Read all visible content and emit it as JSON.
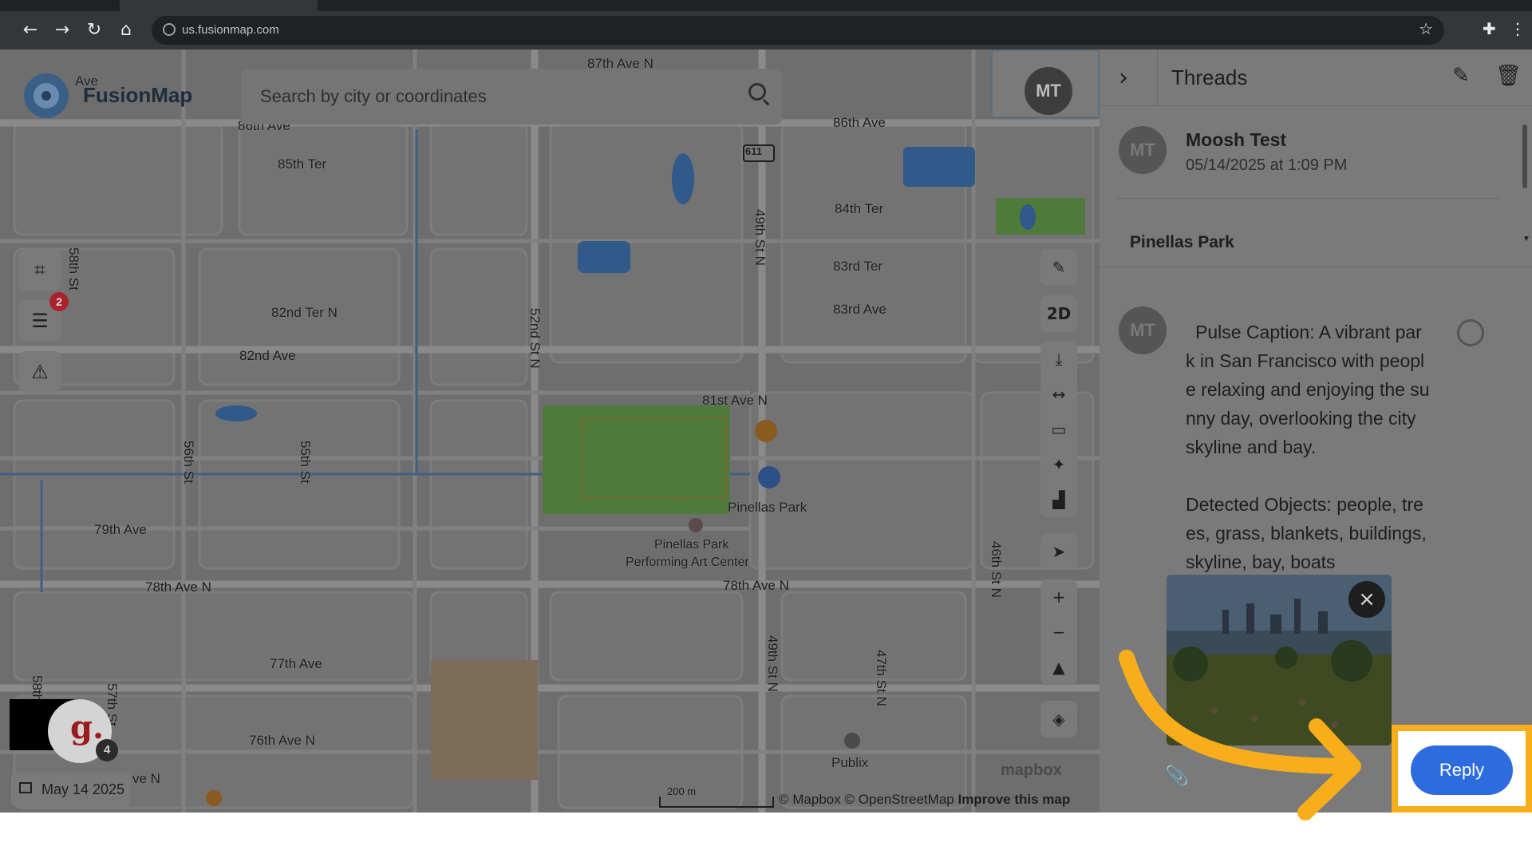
{
  "browser": {
    "url": "us.fusionmap.com",
    "icons": [
      "back-icon",
      "forward-icon",
      "reload-icon",
      "home-icon",
      "star-icon",
      "extensions-icon",
      "menu-icon"
    ]
  },
  "app": {
    "logo_text": "FusionMap",
    "search_placeholder": "Search by city or coordinates",
    "avatar_initials": "MT",
    "left_tools_badge": "2",
    "date": "May 14 2025",
    "g_badge": "4",
    "attribution": {
      "mapbox": "© Mapbox",
      "osm": "© OpenStreetMap",
      "improve": "Improve this map"
    },
    "scale_label": "200 m",
    "mapbox_logo": "mapbox",
    "right_tools": {
      "mode_2d": "2D"
    }
  },
  "map_labels": {
    "horizontal": [
      "87th Ave N",
      "86th Ave",
      "85th Ter",
      "84th Ter",
      "83rd Ter",
      "83rd Ave",
      "82nd Ter N",
      "82nd Ave",
      "81st Ave N",
      "79th Ave",
      "78th Ave N",
      "78th Ave N",
      "77th Ave",
      "76th Ave N",
      "ve N",
      "Ave",
      "86th Ave"
    ],
    "vertical": [
      "58th St",
      "56th St",
      "55th St",
      "52nd St N",
      "49th St N",
      "49th St N",
      "47th St N",
      "46th St N",
      "57th St",
      "58th"
    ],
    "route_shield": "611",
    "places": [
      "Pinellas Park",
      "Pinellas Park",
      "Performing Art Center",
      "Publix"
    ]
  },
  "threads": {
    "title": "Threads",
    "author": "Moosh Test",
    "timestamp": "05/14/2025 at 1:09 PM",
    "location": "Pinellas Park",
    "message_avatar": "MT",
    "caption": "Pulse Caption: A vibrant park in San Francisco with people relaxing and enjoying the sunny day, overlooking the city skyline and bay.",
    "objects": "Detected Objects: people, trees, grass, blankets, buildings, skyline, bay, boats",
    "reply_label": "Reply",
    "close_glyph": "×"
  },
  "colors": {
    "highlight": "#f8ae1b",
    "reply": "#2d6cdf",
    "overlay_dim": "#6b6b6b"
  }
}
